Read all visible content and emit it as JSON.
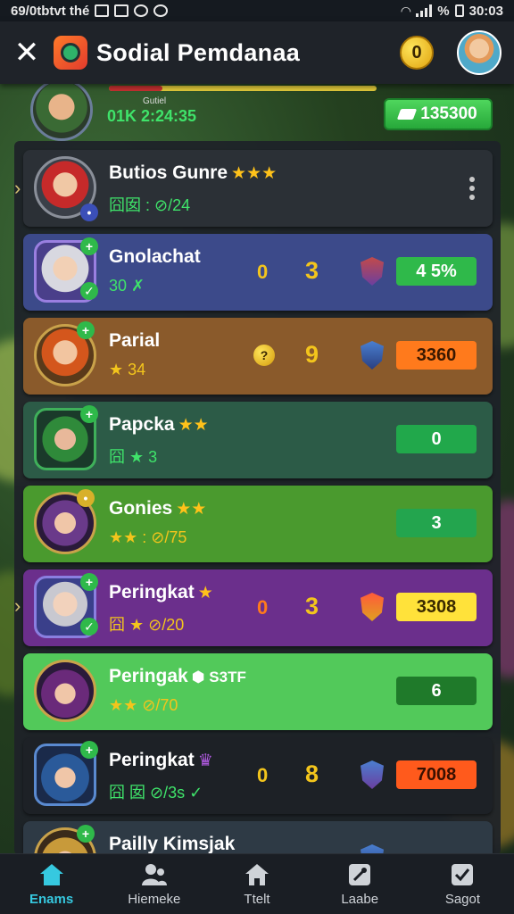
{
  "statusbar": {
    "left_text": "69/0tbtvt thé",
    "right_text": "%",
    "time": "30:03"
  },
  "header": {
    "title": "Sodial Pemdanaa",
    "coin_label": "0"
  },
  "subheader": {
    "label": "Gutiel",
    "time": "01K 2:24:35",
    "gem_value": "135300"
  },
  "rows": [
    {
      "name": "Butios Gunre",
      "stars": "★★★",
      "sub": "囧囡 : ⊘/24",
      "sub_color": "#3fe36a",
      "n1": "",
      "n2": "",
      "pill": "",
      "bg": "#2b3036"
    },
    {
      "name": "Gnolachat",
      "stars": "",
      "sub": "30 ✗",
      "sub_color": "#3fe36a",
      "n1": "0",
      "n2": "3",
      "pill": "4 5%",
      "pill_bg": "#2fb94a",
      "bg": "#3c4a8a"
    },
    {
      "name": "Parial",
      "stars": "",
      "sub": "★ 34",
      "sub_color": "#f3c51c",
      "n1": "",
      "n2": "9",
      "pill": "3360",
      "pill_bg": "#ff7a1c",
      "bg": "#8a5a2b"
    },
    {
      "name": "Papcka",
      "stars": "★★",
      "sub": "囧 ★ 3",
      "sub_color": "#3fe36a",
      "n1": "",
      "n2": "",
      "pill": "0",
      "pill_bg": "#21a84b",
      "bg": "#2c5b47"
    },
    {
      "name": "Gonies",
      "stars": "★★",
      "sub": "★★ : ⊘/75",
      "sub_color": "#f3c51c",
      "n1": "",
      "n2": "",
      "pill": "3",
      "pill_bg": "#23a54e",
      "bg": "#4a9a2e"
    },
    {
      "name": "Peringkat",
      "stars": "★",
      "sub": "囧 ★ ⊘/20",
      "sub_color": "#f3c51c",
      "n1": "0",
      "n2": "3",
      "pill": "3308",
      "pill_bg": "#ffe23a",
      "bg": "#6b2f8c"
    },
    {
      "name": "Peringak",
      "stars": "⬢ S3TF",
      "sub": "★★ ⊘/70",
      "sub_color": "#f3c51c",
      "n1": "",
      "n2": "",
      "pill": "6",
      "pill_bg": "#1f7a2a",
      "bg": "#52c95a"
    },
    {
      "name": "Peringkat",
      "stars": "♛",
      "sub": "囧 囡 ⊘/3s ✓",
      "sub_color": "#3fe36a",
      "n1": "0",
      "n2": "8",
      "pill": "7008",
      "pill_bg": "#ff5a1c",
      "bg": "#1d2126"
    },
    {
      "name": "Pailly Kimsjak",
      "stars": "",
      "sub": "",
      "sub_color": "#3fe36a",
      "n1": "",
      "n2": "",
      "pill": "",
      "pill_bg": "#ff5a1c",
      "bg": "#2e3a45"
    }
  ],
  "nav": [
    {
      "label": "Enams",
      "icon": "home-icon",
      "active": true
    },
    {
      "label": "Hiemeke",
      "icon": "friends-icon",
      "active": false
    },
    {
      "label": "Ttelt",
      "icon": "house-icon",
      "active": false
    },
    {
      "label": "Laabe",
      "icon": "tools-icon",
      "active": false
    },
    {
      "label": "Sagot",
      "icon": "check-icon",
      "active": false
    }
  ]
}
